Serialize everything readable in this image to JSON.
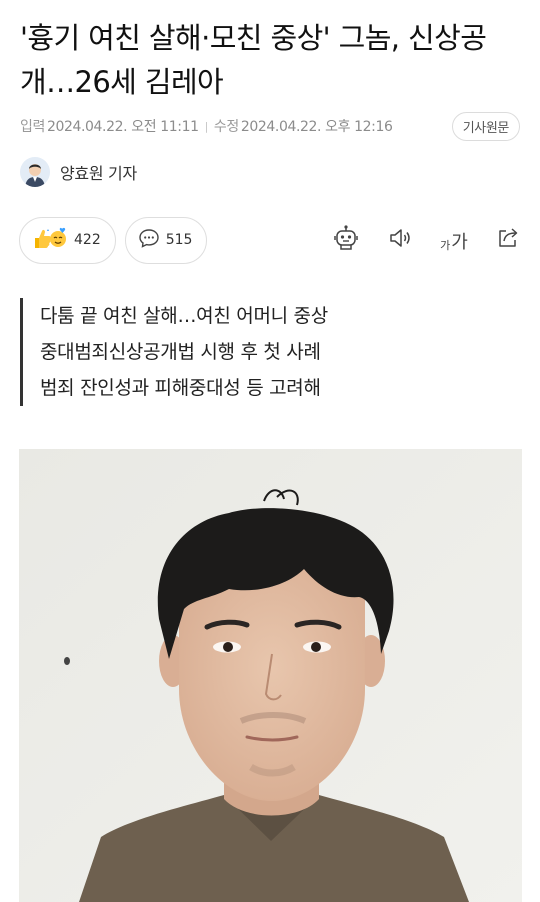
{
  "article": {
    "headline": "'흉기 여친 살해·모친 중상' 그놈, 신상공개…26세 김레아"
  },
  "meta": {
    "published_label": "입력",
    "published_value": "2024.04.22. 오전 11:11",
    "modified_label": "수정",
    "modified_value": "2024.04.22. 오후 12:16",
    "source_button": "기사원문"
  },
  "byline": {
    "reporter": "양효원 기자"
  },
  "actions": {
    "reaction_count": "422",
    "comment_count": "515",
    "font_small": "가",
    "font_large": "가"
  },
  "summary": [
    "다툼 끝 여친 살해…여친 어머니 중상",
    "중대범죄신상공개법 시행 후 첫 사례",
    "범죄 잔인성과 피해중대성 등 고려해"
  ]
}
